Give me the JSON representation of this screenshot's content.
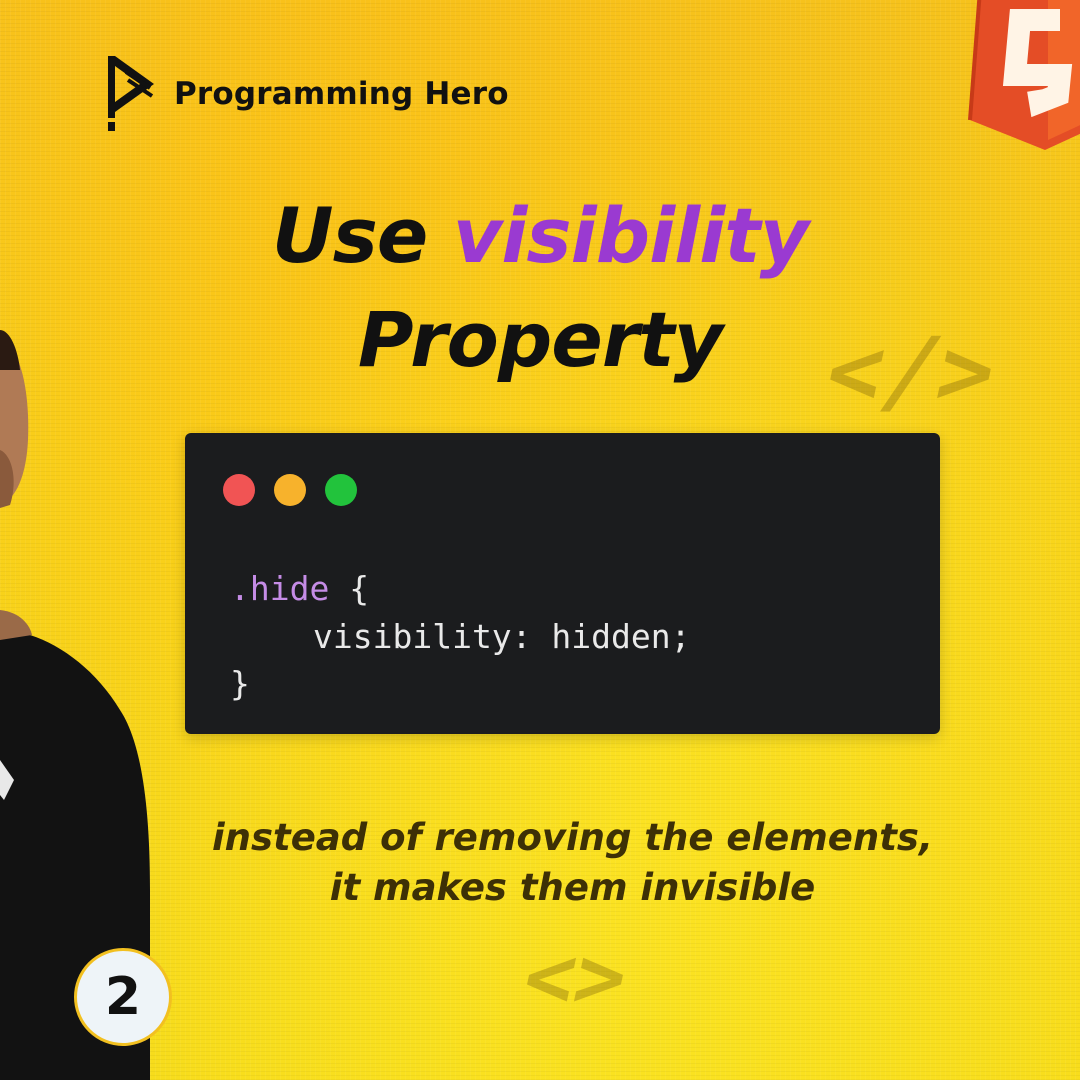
{
  "brand": {
    "name": "Programming Hero"
  },
  "headline": {
    "line1_plain": "Use ",
    "line1_accent": "visibility",
    "line2": "Property"
  },
  "code": {
    "line1_selector": ".hide",
    "line1_brace": " {",
    "line2": "visibility: hidden;",
    "line3": "}"
  },
  "caption": {
    "line1": "instead of removing the elements,",
    "line2": "it makes them invisible"
  },
  "decorations": {
    "tag_top": "</>",
    "tag_bottom": "<>"
  },
  "slide_number": "2",
  "colors": {
    "background": "#f7cf1b",
    "accent": "#9a3ad1",
    "code_bg": "#1b1c1e",
    "dot_red": "#f15454",
    "dot_yellow": "#f7b22c",
    "dot_green": "#22c33c",
    "html5_orange": "#e44d26"
  },
  "icons": {
    "brand_logo": "programming-hero-logo-icon",
    "html5": "html5-logo-icon"
  }
}
